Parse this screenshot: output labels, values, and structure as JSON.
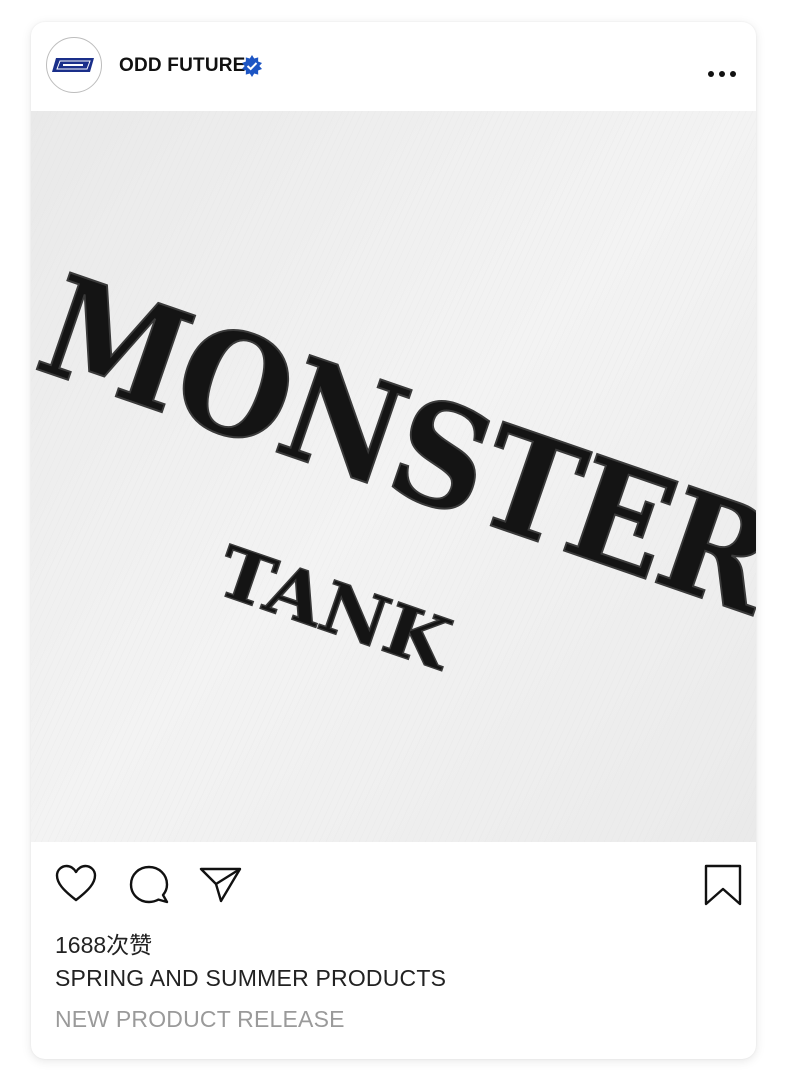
{
  "post": {
    "account_name": "ODD FUTURE",
    "verified": true,
    "verified_icon": "verified-badge-icon",
    "menu_icon": "more-options-icon",
    "avatar_logo_text": "ODD FUTURE",
    "photo": {
      "headline": "MONSTER",
      "subline": "TANK"
    },
    "actions": {
      "like_icon": "heart-icon",
      "comment_icon": "comment-icon",
      "share_icon": "paper-plane-icon",
      "save_icon": "bookmark-icon"
    },
    "likes_text": "1688次赞",
    "caption": "SPRING AND SUMMER PRODUCTS",
    "subcaption": "NEW PRODUCT RELEASE"
  },
  "colors": {
    "brand_blue": "#1a2f8a",
    "text_dark": "#222222",
    "text_muted": "#9a9a9a",
    "fabric": "#efefef"
  }
}
